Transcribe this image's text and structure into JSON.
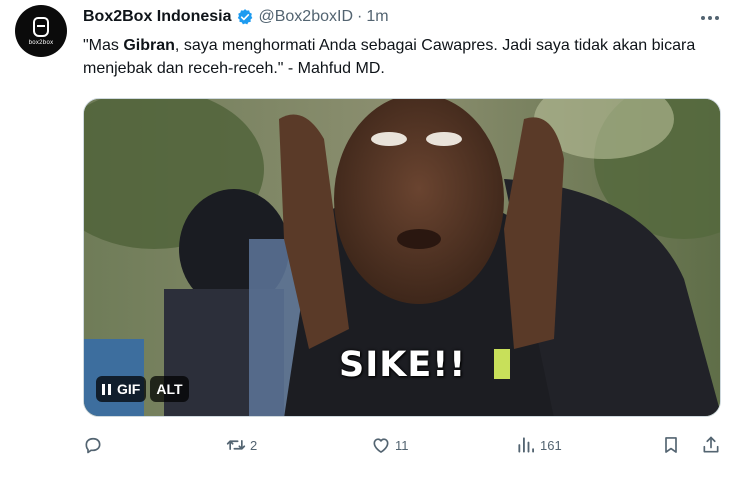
{
  "author": {
    "avatar_text": "box2box",
    "name": "Box2Box Indonesia",
    "handle": "@Box2boxID",
    "separator": "·",
    "time": "1m"
  },
  "tweet": {
    "text_before": "\"Mas ",
    "text_bold": "Gibran",
    "text_after": ", saya menghormati Anda sebagai Cawapres. Jadi saya tidak akan bicara menjebak dan receh-receh.\" - Mahfud MD."
  },
  "media": {
    "type": "GIF",
    "caption": "SIKE!!",
    "gif_badge": "GIF",
    "alt_badge": "ALT"
  },
  "actions": {
    "reply_count": "",
    "retweet_count": "2",
    "like_count": "11",
    "views_count": "161"
  },
  "colors": {
    "verified": "#1d9bf0",
    "secondary_text": "#536471",
    "primary_text": "#0f1419"
  }
}
